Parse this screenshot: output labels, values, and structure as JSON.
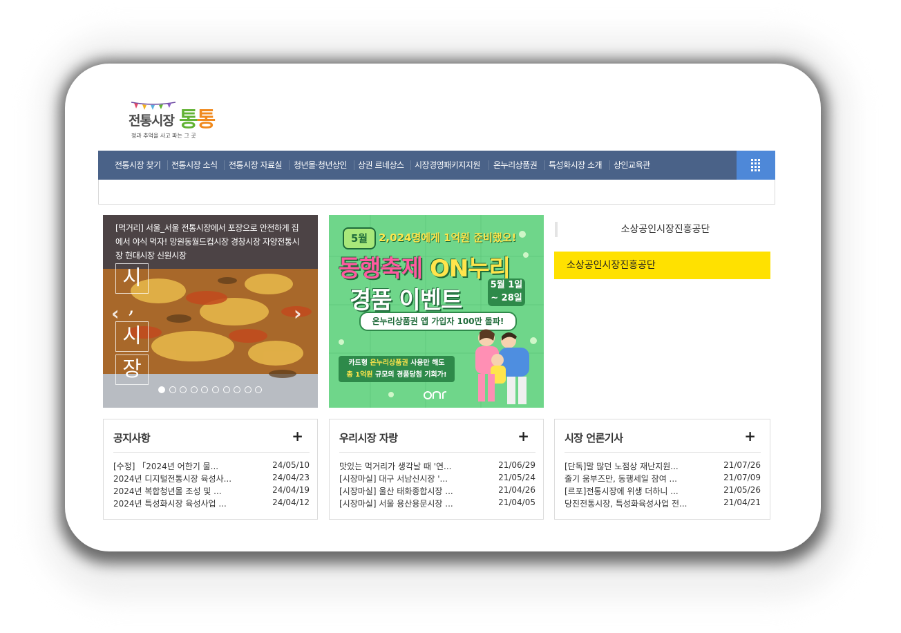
{
  "logo": {
    "word": "전통시장",
    "accent_a": "통",
    "accent_b": "통",
    "tagline": "정과 추억을 사고 파는 그 곳"
  },
  "gnb": {
    "items": [
      "전통시장 찾기",
      "전통시장 소식",
      "전통시장 자료실",
      "청년몰·청년상인",
      "상권 르네상스",
      "시장경영패키지지원",
      "온누리상품권",
      "특성화시장 소개",
      "상인교육관"
    ]
  },
  "slider": {
    "caption": "[먹거리] 서울_서울 전통시장에서 포장으로 안전하게 집에서 야식 먹자! 망원동월드컵시장 경창시장 자양전통시장 현대시장 신원시장",
    "vertical_text": [
      "시",
      ",",
      "시",
      "장"
    ],
    "prev_label": "‹",
    "next_label": "›",
    "dot_count": 10,
    "active_dot": 1
  },
  "banner": {
    "month": "5월",
    "headline": "2,024명에게 1억원 준비했오!",
    "title_a": "동행",
    "title_b": "축제",
    "title_c": " ON누리",
    "title2": "경품 이벤트",
    "date_line1": "5월 1일",
    "date_line2": "~ 28일",
    "pill": "온누리상품권 앱 가입자 100만 돌파!",
    "box_line1_a": "카드형 ",
    "box_line1_b": "온누리상품권",
    "box_line1_c": " 사용만 해도",
    "box_line2_a": "총 1억원",
    "box_line2_b": " 규모의 경품당첨 기회가!"
  },
  "side": {
    "title": "소상공인시장진흥공단",
    "button": "소상공인시장진흥공단"
  },
  "boards": [
    {
      "title": "공지사항",
      "more": "+",
      "rows": [
        {
          "title": "[수정] 「2024년 어한기 물...",
          "date": "24/05/10"
        },
        {
          "title": "2024년 디지털전통시장 육성사...",
          "date": "24/04/23"
        },
        {
          "title": "2024년 복합청년몰 조성 및 ...",
          "date": "24/04/19"
        },
        {
          "title": "2024년 특성화시장 육성사업 ...",
          "date": "24/04/12"
        }
      ]
    },
    {
      "title": "우리시장 자랑",
      "more": "+",
      "rows": [
        {
          "title": "맛있는 먹거리가 생각날 때 '연...",
          "date": "21/06/29"
        },
        {
          "title": "[시장마실] 대구 서남신시장 '...",
          "date": "21/05/24"
        },
        {
          "title": "[시장마실] 울산 태화종합시장 ...",
          "date": "21/04/26"
        },
        {
          "title": "[시장마실] 서울 용산용문시장 ...",
          "date": "21/04/05"
        }
      ]
    },
    {
      "title": "시장 언론기사",
      "more": "+",
      "rows": [
        {
          "title": "[단독]말 많던 노점상 재난지원...",
          "date": "21/07/26"
        },
        {
          "title": "줄기 움부즈만, 동행세일 참여 ...",
          "date": "21/07/09"
        },
        {
          "title": "[르포]전통시장에 위생 더하니 ...",
          "date": "21/05/26"
        },
        {
          "title": "당진전통시장, 특성화육성사업 전...",
          "date": "21/04/21"
        }
      ]
    }
  ],
  "colors": {
    "gnb_bg": "#4a6288",
    "allmenu_bg": "#4e88d8",
    "side_button_bg": "#ffe100",
    "banner_bg": "#6fd68a"
  },
  "icons": {
    "allmenu": "grid-icon",
    "board_more": "plus-icon"
  }
}
